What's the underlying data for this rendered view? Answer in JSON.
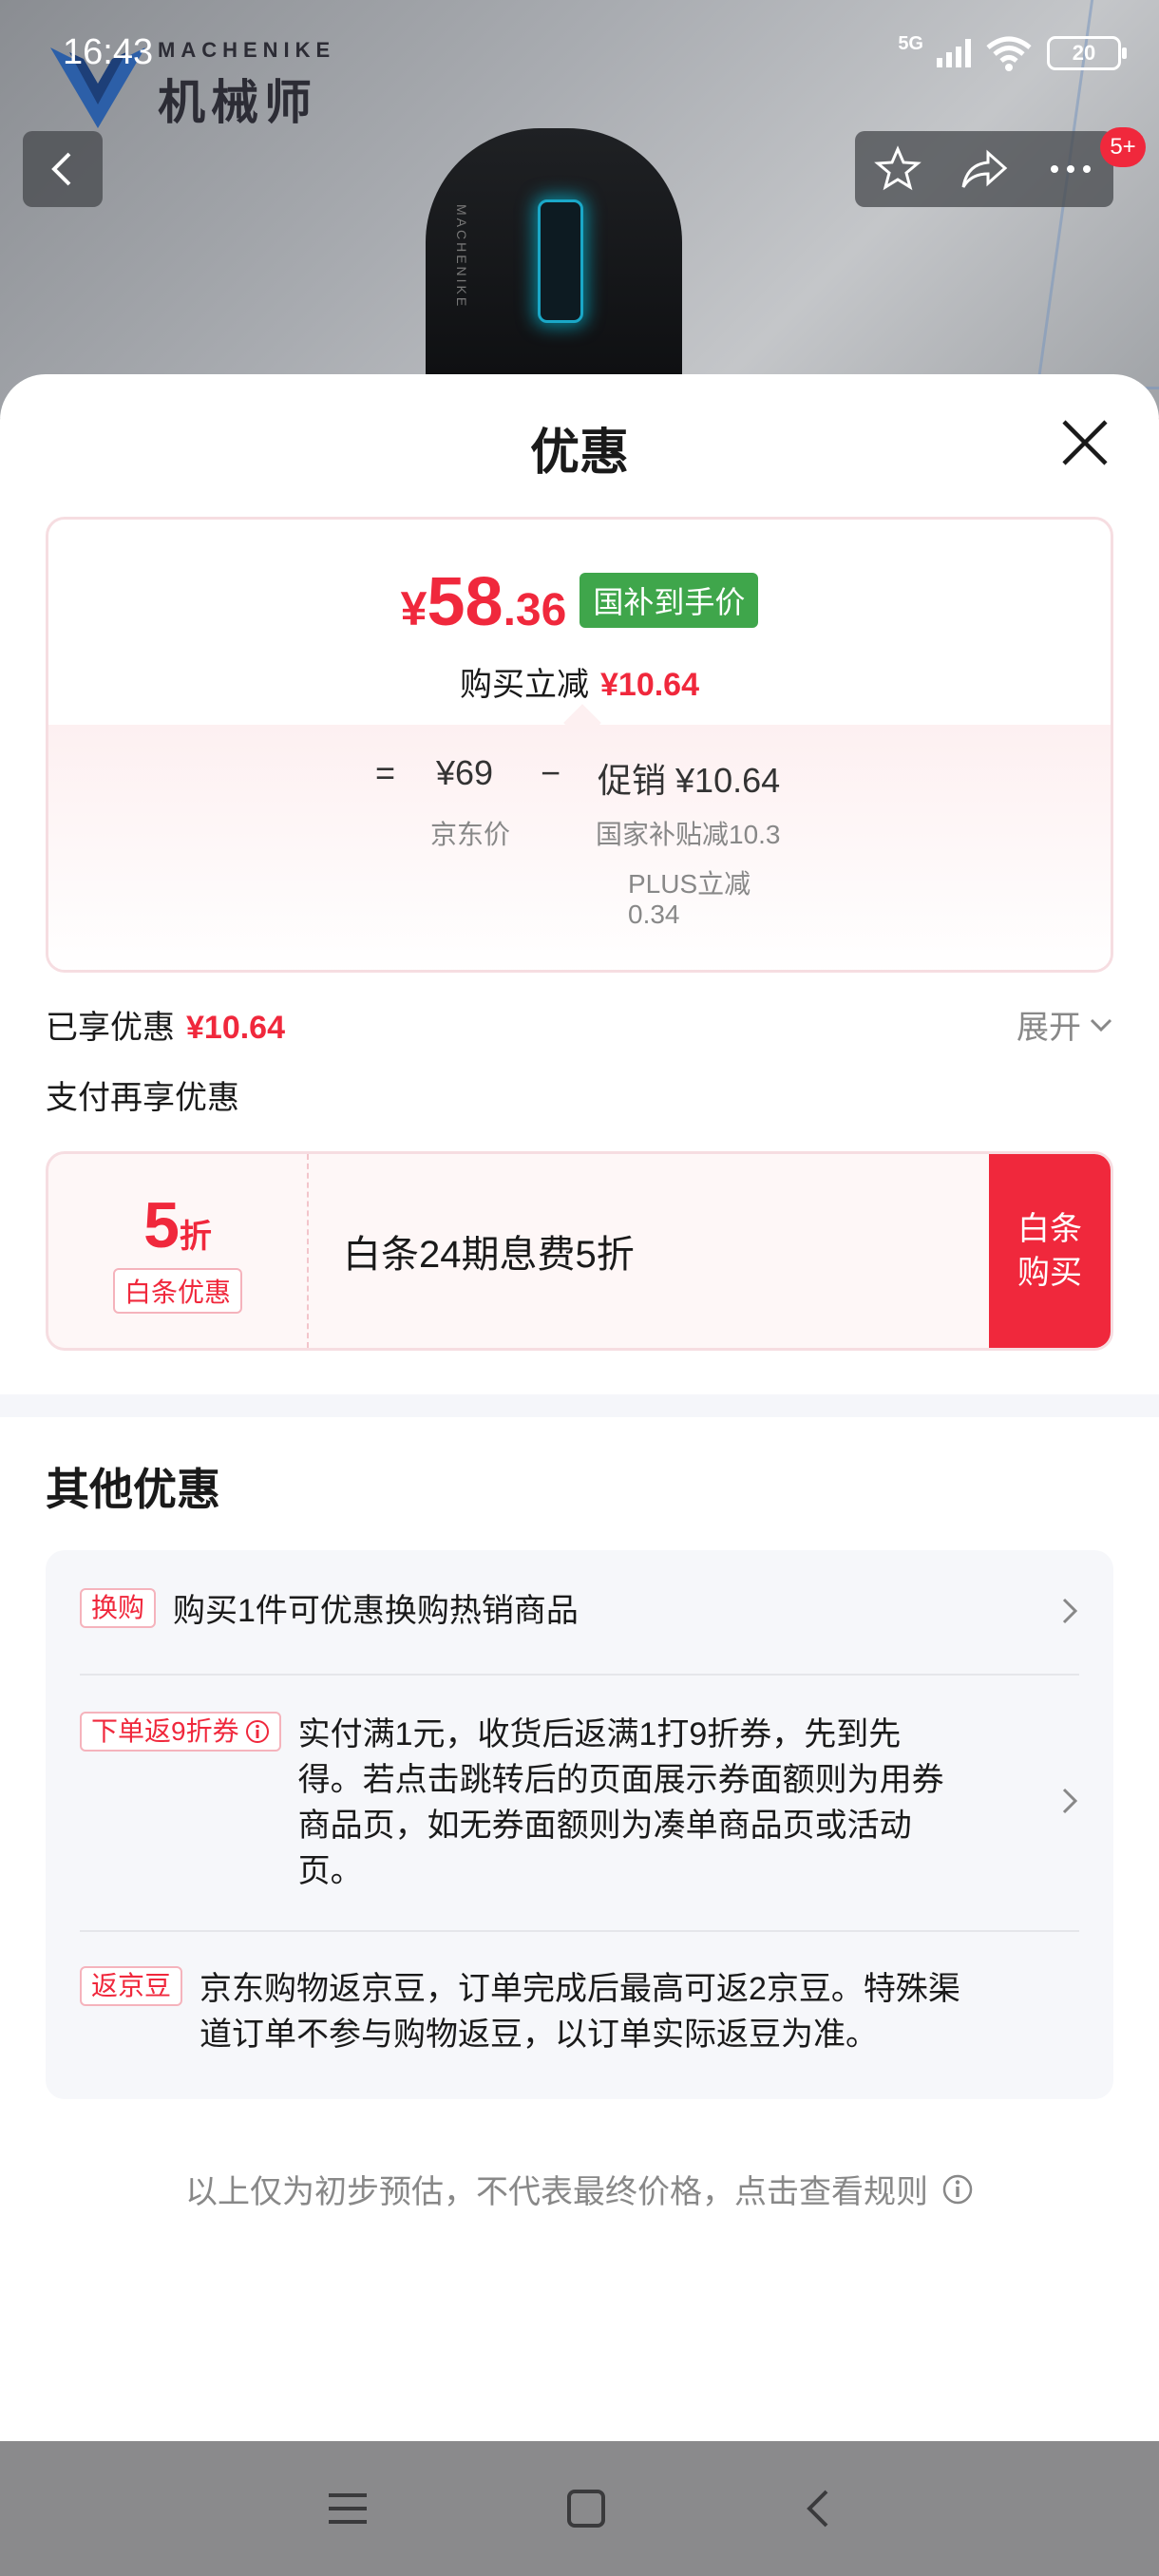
{
  "status_bar": {
    "time": "16:43",
    "network": "5G",
    "battery": "20"
  },
  "brand": {
    "name_en": "MACHENIKE",
    "name_cn": "机械师"
  },
  "product_nav": {
    "badge": "5+"
  },
  "sheet": {
    "title": "优惠",
    "price_card": {
      "final_yen": "¥",
      "final_int": "58",
      "final_dec": ".36",
      "final_tag": "国补到手价",
      "instant_label": "购买立减",
      "instant_value": "¥10.64",
      "eq": "=",
      "jd_price": "¥69",
      "jd_price_label": "京东价",
      "minus": "−",
      "promo_prefix": "促销",
      "promo_value": "¥10.64",
      "promo_detail_1": "国家补贴减10.3",
      "promo_detail_2a": "PLUS立减",
      "promo_detail_2b": "0.34"
    },
    "enjoyed_label": "已享优惠",
    "enjoyed_value": "¥10.64",
    "expand_label": "展开",
    "pay_more_label": "支付再享优惠",
    "baitiao": {
      "discount_num": "5",
      "discount_unit": "折",
      "tag": "白条优惠",
      "desc": "白条24期息费5折",
      "btn_line1": "白条",
      "btn_line2": "购买"
    },
    "other_title": "其他优惠",
    "other_offers": [
      {
        "tag": "换购",
        "text": "购买1件可优惠换购热销商品"
      },
      {
        "tag": "下单返9折券",
        "text_lines": [
          "实付满1元，收货后返满1打9折券，先到先",
          "得。若点击跳转后的页面展示券面额则为用券",
          "商品页，如无券面额则为凑单商品页或活动",
          "页。"
        ]
      },
      {
        "tag": "返京豆",
        "text_lines": [
          "京东购物返京豆，订单完成后最高可返2京豆。特殊渠",
          "道订单不参与购物返豆，以订单实际返豆为准。"
        ]
      }
    ],
    "footer_note": "以上仅为初步预估，不代表最终价格，点击查看规则"
  },
  "colors": {
    "accent_red": "#f0283c",
    "tag_green": "#3fa64b",
    "muted": "#888888"
  }
}
